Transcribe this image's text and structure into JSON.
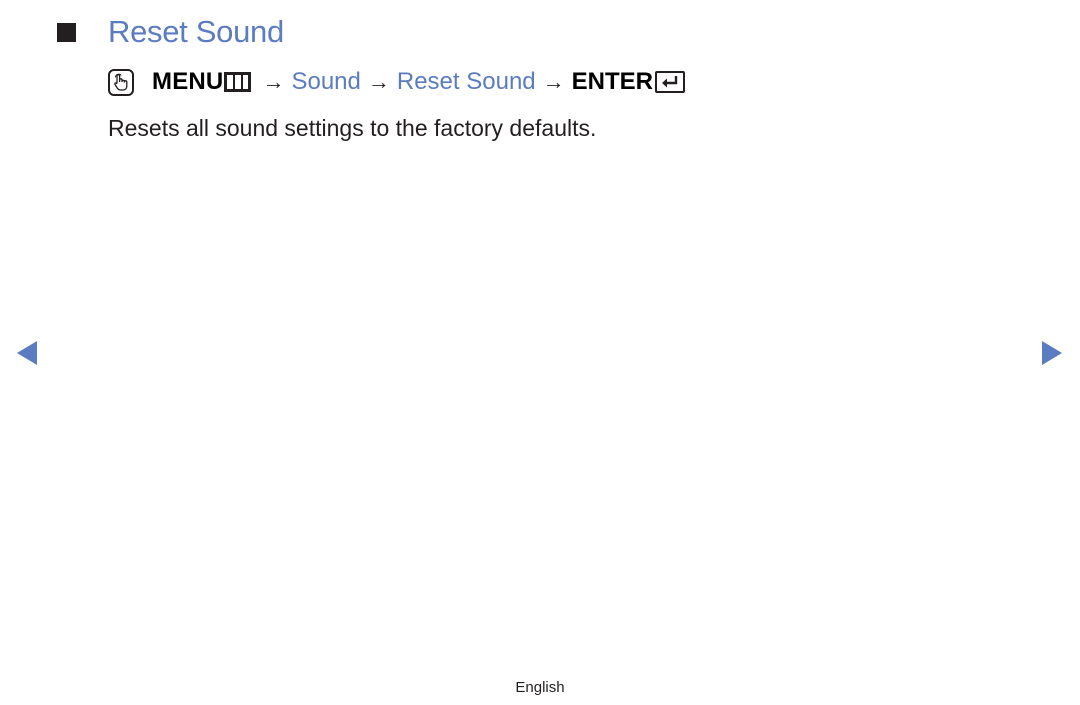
{
  "section": {
    "title": "Reset Sound",
    "bullet_icon": "black-square-bullet"
  },
  "path": {
    "hand_icon": "remote-touch-hand-icon",
    "menu_label": "MENU",
    "menu_icon": "menu-grid-icon",
    "arrow": "→",
    "items": [
      "Sound",
      "Reset Sound"
    ],
    "enter_label": "ENTER",
    "enter_icon": "enter-return-icon"
  },
  "description": "Resets all sound settings to the factory defaults.",
  "navigation": {
    "prev_icon": "left-triangle-icon",
    "next_icon": "right-triangle-icon"
  },
  "footer": {
    "language": "English"
  },
  "colors": {
    "accent": "#5b7cc1",
    "text": "#231f20"
  }
}
